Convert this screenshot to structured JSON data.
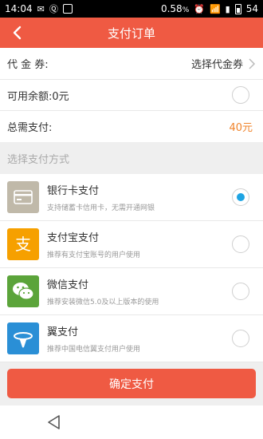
{
  "status_bar": {
    "time": "14:04",
    "data_speed": "0.58",
    "data_unit": "%",
    "battery": "54"
  },
  "header": {
    "title": "支付订单"
  },
  "voucher": {
    "label": "代 金 券:",
    "action": "选择代金券"
  },
  "balance": {
    "label": "可用余额:",
    "value": "0元"
  },
  "total": {
    "label": "总需支付:",
    "value": "40元"
  },
  "section": {
    "label": "选择支付方式"
  },
  "payment_methods": [
    {
      "title": "银行卡支付",
      "desc": "支持储蓄卡信用卡，无需开通网银",
      "icon": "bank-card-icon",
      "color": "#c0b9a9",
      "selected": true
    },
    {
      "title": "支付宝支付",
      "desc": "推荐有支付宝账号的用户使用",
      "icon": "alipay-icon",
      "color": "#f6a000",
      "selected": false
    },
    {
      "title": "微信支付",
      "desc": "推荐安装微信5.0及以上版本的使用",
      "icon": "wechat-icon",
      "color": "#5ba43a",
      "selected": false
    },
    {
      "title": "翼支付",
      "desc": "推荐中国电信翼支付用户使用",
      "icon": "telecom-pay-icon",
      "color": "#2a8fd6",
      "selected": false
    }
  ],
  "confirm": {
    "label": "确定支付"
  },
  "colors": {
    "primary": "#ef5a43",
    "selected_radio": "#1ea4e3",
    "amount": "#f0842c"
  }
}
